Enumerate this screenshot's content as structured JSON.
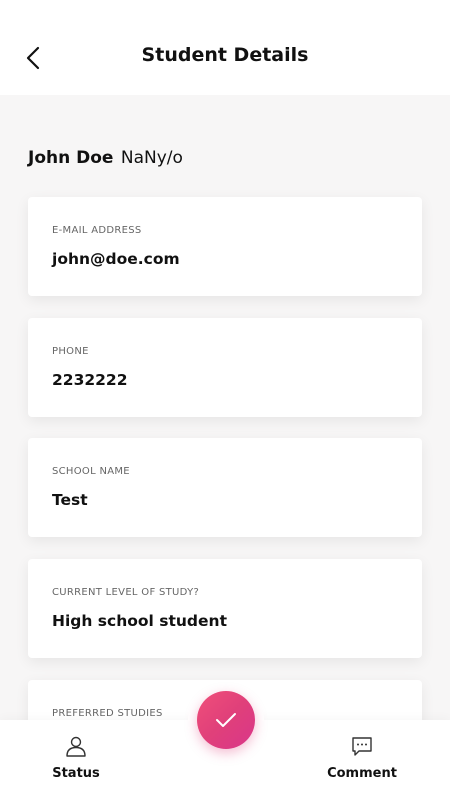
{
  "header": {
    "title": "Student Details",
    "back_icon": "chevron-left-icon"
  },
  "student": {
    "name": "John Doe",
    "suffix": "NaNy/o"
  },
  "fields": [
    {
      "label": "E-MAIL ADDRESS",
      "value": "john@doe.com"
    },
    {
      "label": "PHONE",
      "value": "2232222"
    },
    {
      "label": "SCHOOL NAME",
      "value": "Test"
    },
    {
      "label": "CURRENT LEVEL OF STUDY?",
      "value": "High school student"
    },
    {
      "label": "PREFERRED STUDIES",
      "value": ""
    }
  ],
  "bottom_nav": {
    "status_label": "Status",
    "status_icon": "person-icon",
    "comment_label": "Comment",
    "comment_icon": "chat-bubble-icon",
    "confirm_icon": "checkmark-icon"
  },
  "colors": {
    "accent_gradient_start": "#f04f7a",
    "accent_gradient_end": "#d9368a",
    "background": "#f7f6f6",
    "card": "#ffffff"
  }
}
